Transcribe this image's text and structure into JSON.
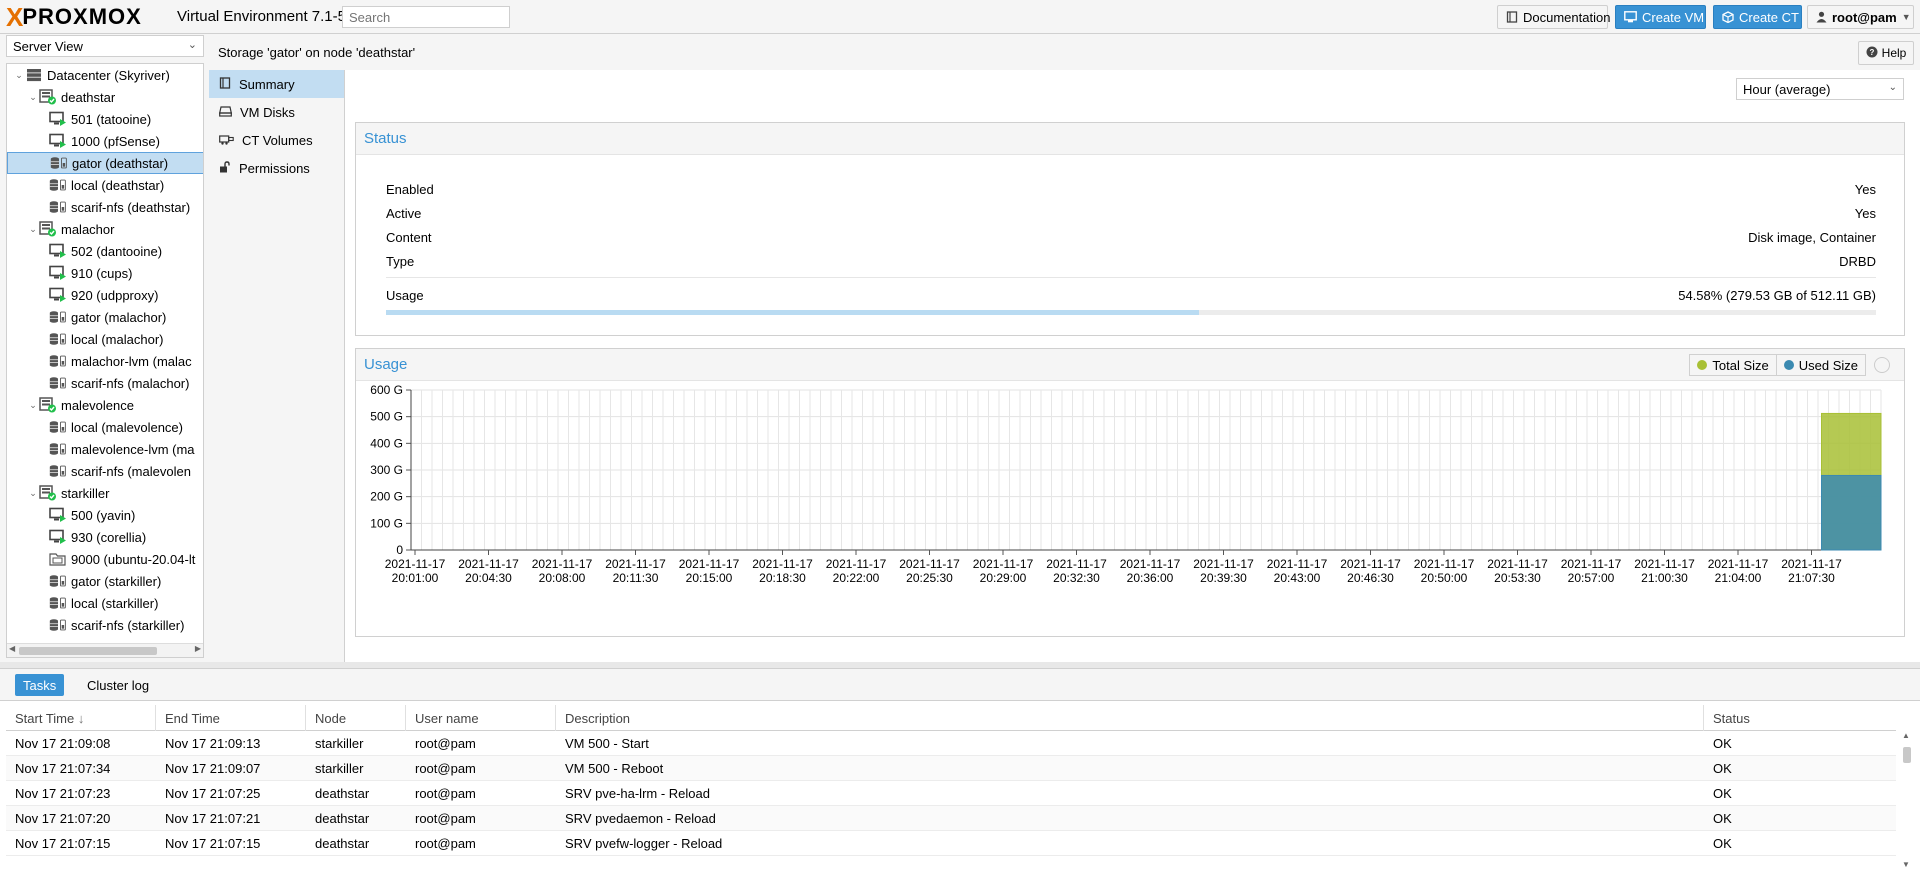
{
  "topbar": {
    "logo_x": "X",
    "logo_word": "PROXMOX",
    "version": "Virtual Environment 7.1-5",
    "search_placeholder": "Search",
    "doc_label": "Documentation",
    "create_vm_label": "Create VM",
    "create_ct_label": "Create CT",
    "user_label": "root@pam"
  },
  "sidebar": {
    "view_label": "Server View",
    "tree": [
      {
        "label": "Datacenter (Skyriver)",
        "type": "datacenter",
        "level": 0
      },
      {
        "label": "deathstar",
        "type": "node",
        "level": 1
      },
      {
        "label": "501 (tatooine)",
        "type": "vm",
        "level": 2
      },
      {
        "label": "1000 (pfSense)",
        "type": "vm",
        "level": 2
      },
      {
        "label": "gator (deathstar)",
        "type": "storage",
        "level": 2,
        "selected": true
      },
      {
        "label": "local (deathstar)",
        "type": "storage",
        "level": 2
      },
      {
        "label": "scarif-nfs (deathstar)",
        "type": "storage",
        "level": 2
      },
      {
        "label": "malachor",
        "type": "node",
        "level": 1
      },
      {
        "label": "502 (dantooine)",
        "type": "vm",
        "level": 2
      },
      {
        "label": "910 (cups)",
        "type": "vm",
        "level": 2
      },
      {
        "label": "920 (udpproxy)",
        "type": "vm",
        "level": 2
      },
      {
        "label": "gator (malachor)",
        "type": "storage",
        "level": 2
      },
      {
        "label": "local (malachor)",
        "type": "storage",
        "level": 2
      },
      {
        "label": "malachor-lvm (malac",
        "type": "storage",
        "level": 2
      },
      {
        "label": "scarif-nfs (malachor)",
        "type": "storage",
        "level": 2
      },
      {
        "label": "malevolence",
        "type": "node",
        "level": 1
      },
      {
        "label": "local (malevolence)",
        "type": "storage",
        "level": 2
      },
      {
        "label": "malevolence-lvm (ma",
        "type": "storage",
        "level": 2
      },
      {
        "label": "scarif-nfs (malevolen",
        "type": "storage",
        "level": 2
      },
      {
        "label": "starkiller",
        "type": "node",
        "level": 1
      },
      {
        "label": "500 (yavin)",
        "type": "vm",
        "level": 2
      },
      {
        "label": "930 (corellia)",
        "type": "vm",
        "level": 2
      },
      {
        "label": "9000 (ubuntu-20.04-lt",
        "type": "template",
        "level": 2
      },
      {
        "label": "gator (starkiller)",
        "type": "storage",
        "level": 2
      },
      {
        "label": "local (starkiller)",
        "type": "storage",
        "level": 2
      },
      {
        "label": "scarif-nfs (starkiller)",
        "type": "storage",
        "level": 2
      }
    ]
  },
  "content": {
    "title": "Storage 'gator' on node 'deathstar'",
    "help_label": "Help",
    "nav": [
      {
        "label": "Summary",
        "icon": "book-icon",
        "active": true
      },
      {
        "label": "VM Disks",
        "icon": "hdd-icon"
      },
      {
        "label": "CT Volumes",
        "icon": "cube-icon"
      },
      {
        "label": "Permissions",
        "icon": "unlock-icon"
      }
    ],
    "timeframe": "Hour (average)"
  },
  "status": {
    "title": "Status",
    "rows": [
      {
        "key": "Enabled",
        "value": "Yes"
      },
      {
        "key": "Active",
        "value": "Yes"
      },
      {
        "key": "Content",
        "value": "Disk image, Container"
      },
      {
        "key": "Type",
        "value": "DRBD"
      }
    ],
    "usage_label": "Usage",
    "usage_value": "54.58% (279.53 GB of 512.11 GB)",
    "usage_fraction": 0.5458
  },
  "usage_chart": {
    "title": "Usage",
    "legend_total": "Total Size",
    "legend_used": "Used Size",
    "total_color": "#a8c035",
    "used_color": "#3b8ab1"
  },
  "chart_data": {
    "type": "area",
    "title": "Usage",
    "yticks": [
      "0",
      "100 G",
      "200 G",
      "300 G",
      "400 G",
      "500 G",
      "600 G"
    ],
    "ylim": [
      0,
      600
    ],
    "x": [
      [
        "2021-11-17",
        "20:01:00"
      ],
      [
        "2021-11-17",
        "20:04:30"
      ],
      [
        "2021-11-17",
        "20:08:00"
      ],
      [
        "2021-11-17",
        "20:11:30"
      ],
      [
        "2021-11-17",
        "20:15:00"
      ],
      [
        "2021-11-17",
        "20:18:30"
      ],
      [
        "2021-11-17",
        "20:22:00"
      ],
      [
        "2021-11-17",
        "20:25:30"
      ],
      [
        "2021-11-17",
        "20:29:00"
      ],
      [
        "2021-11-17",
        "20:32:30"
      ],
      [
        "2021-11-17",
        "20:36:00"
      ],
      [
        "2021-11-17",
        "20:39:30"
      ],
      [
        "2021-11-17",
        "20:43:00"
      ],
      [
        "2021-11-17",
        "20:46:30"
      ],
      [
        "2021-11-17",
        "20:50:00"
      ],
      [
        "2021-11-17",
        "20:53:30"
      ],
      [
        "2021-11-17",
        "20:57:00"
      ],
      [
        "2021-11-17",
        "21:00:30"
      ],
      [
        "2021-11-17",
        "21:04:00"
      ],
      [
        "2021-11-17",
        "21:07:30"
      ]
    ],
    "series": [
      {
        "name": "Total Size",
        "values": [
          null,
          null,
          null,
          null,
          null,
          null,
          null,
          null,
          null,
          null,
          null,
          null,
          null,
          null,
          null,
          null,
          null,
          null,
          null,
          512.11
        ]
      },
      {
        "name": "Used Size",
        "values": [
          null,
          null,
          null,
          null,
          null,
          null,
          null,
          null,
          null,
          null,
          null,
          null,
          null,
          null,
          null,
          null,
          null,
          null,
          null,
          279.53
        ]
      }
    ]
  },
  "tasks": {
    "tabs": [
      {
        "label": "Tasks",
        "active": true
      },
      {
        "label": "Cluster log"
      }
    ],
    "columns": [
      "Start Time",
      "End Time",
      "Node",
      "User name",
      "Description",
      "Status"
    ],
    "rows": [
      [
        "Nov 17 21:09:08",
        "Nov 17 21:09:13",
        "starkiller",
        "root@pam",
        "VM 500 - Start",
        "OK"
      ],
      [
        "Nov 17 21:07:34",
        "Nov 17 21:09:07",
        "starkiller",
        "root@pam",
        "VM 500 - Reboot",
        "OK"
      ],
      [
        "Nov 17 21:07:23",
        "Nov 17 21:07:25",
        "deathstar",
        "root@pam",
        "SRV pve-ha-lrm - Reload",
        "OK"
      ],
      [
        "Nov 17 21:07:20",
        "Nov 17 21:07:21",
        "deathstar",
        "root@pam",
        "SRV pvedaemon - Reload",
        "OK"
      ],
      [
        "Nov 17 21:07:15",
        "Nov 17 21:07:15",
        "deathstar",
        "root@pam",
        "SRV pvefw-logger - Reload",
        "OK"
      ]
    ]
  }
}
